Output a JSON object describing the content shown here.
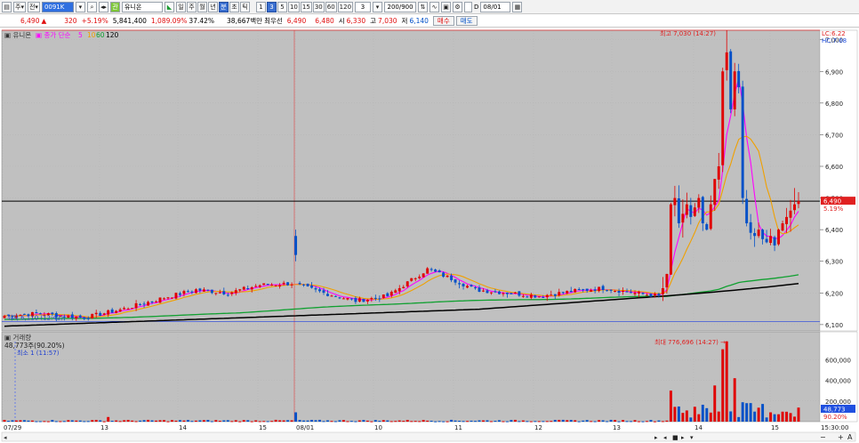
{
  "toolbar": {
    "chart_icon": "chart-icon",
    "period_label": "주",
    "list_label": "전",
    "code": "0091K",
    "search_icon": "search-icon",
    "nav_icon": "prev-next-icon",
    "stock_badge": "관",
    "stock_name": "유니온",
    "tabs": [
      "일",
      "주",
      "월",
      "년",
      "분",
      "초",
      "틱"
    ],
    "active_tab": "분",
    "intervals": [
      "1",
      "3",
      "5",
      "10",
      "15",
      "30",
      "60",
      "120"
    ],
    "active_interval": "3",
    "interval_select": "3",
    "count": "200/900",
    "date_checkbox_label": "D",
    "date_value": "08/01"
  },
  "quote": {
    "price": "6,490",
    "arrow": "▲",
    "change": "320",
    "change_pct": "+5.19%",
    "volume": "5,841,400",
    "volume_ratio": "1,089.09%",
    "turnover_ratio": "37.42%",
    "amount": "38,667백만",
    "ask_label": "최우선",
    "ask_price": "6,490",
    "bid_price": "6,480",
    "open_label": "시",
    "open": "6,330",
    "high_label": "고",
    "high": "7,030",
    "low_label": "저",
    "low": "6,140",
    "buy_button": "매수",
    "sell_button": "매도"
  },
  "chart_data": {
    "type": "candlestick",
    "price_panel": {
      "header_name": "유니온",
      "ma_legend_prefix": "종가 단순",
      "ma_periods": [
        "5",
        "10",
        "60",
        "120"
      ],
      "ma_colors": {
        "5": "#ff00ff",
        "10": "#f0a000",
        "60": "#10a030",
        "120": "#000000"
      },
      "y_ticks": [
        "7,000",
        "6,900",
        "6,800",
        "6,700",
        "6,600",
        "6,500",
        "6,400",
        "6,300",
        "6,200",
        "6,100"
      ],
      "ylim": [
        6080,
        7030
      ],
      "lc_label": "LC:6.22",
      "hc_label": "HC:7.68",
      "high_annotation": "최고 7,030 (14:27)",
      "low_annotation": "최저 6,110 (12:42)",
      "current_price_tag": "6,490",
      "current_pct_tag": "5.19%",
      "high_price": 7030,
      "low_price": 6110,
      "current_price": 6490
    },
    "volume_panel": {
      "title": "거래량",
      "value_line": "48,773주(90.20%)",
      "min_annotation": "최소 1 (11:57)",
      "max_annotation": "최대 776,696 (14:27)",
      "y_ticks": [
        "600,000",
        "400,000",
        "200,000"
      ],
      "ylim": [
        0,
        800000
      ],
      "current_tag": "48,773",
      "pct_tag": "90.20%"
    },
    "x_labels": [
      "07/29",
      "13",
      "14",
      "15",
      "08/01",
      "10",
      "11",
      "12",
      "13",
      "14",
      "15",
      "15:30:00"
    ],
    "colors": {
      "up": "#e00000",
      "down": "#0050c8",
      "ma5": "#ff00ff",
      "ma10": "#f0a000",
      "ma60": "#10a030",
      "ma120": "#000000"
    }
  },
  "statusbar": {
    "zoom_out": "−",
    "zoom_in": "+",
    "auto_label": "A"
  }
}
